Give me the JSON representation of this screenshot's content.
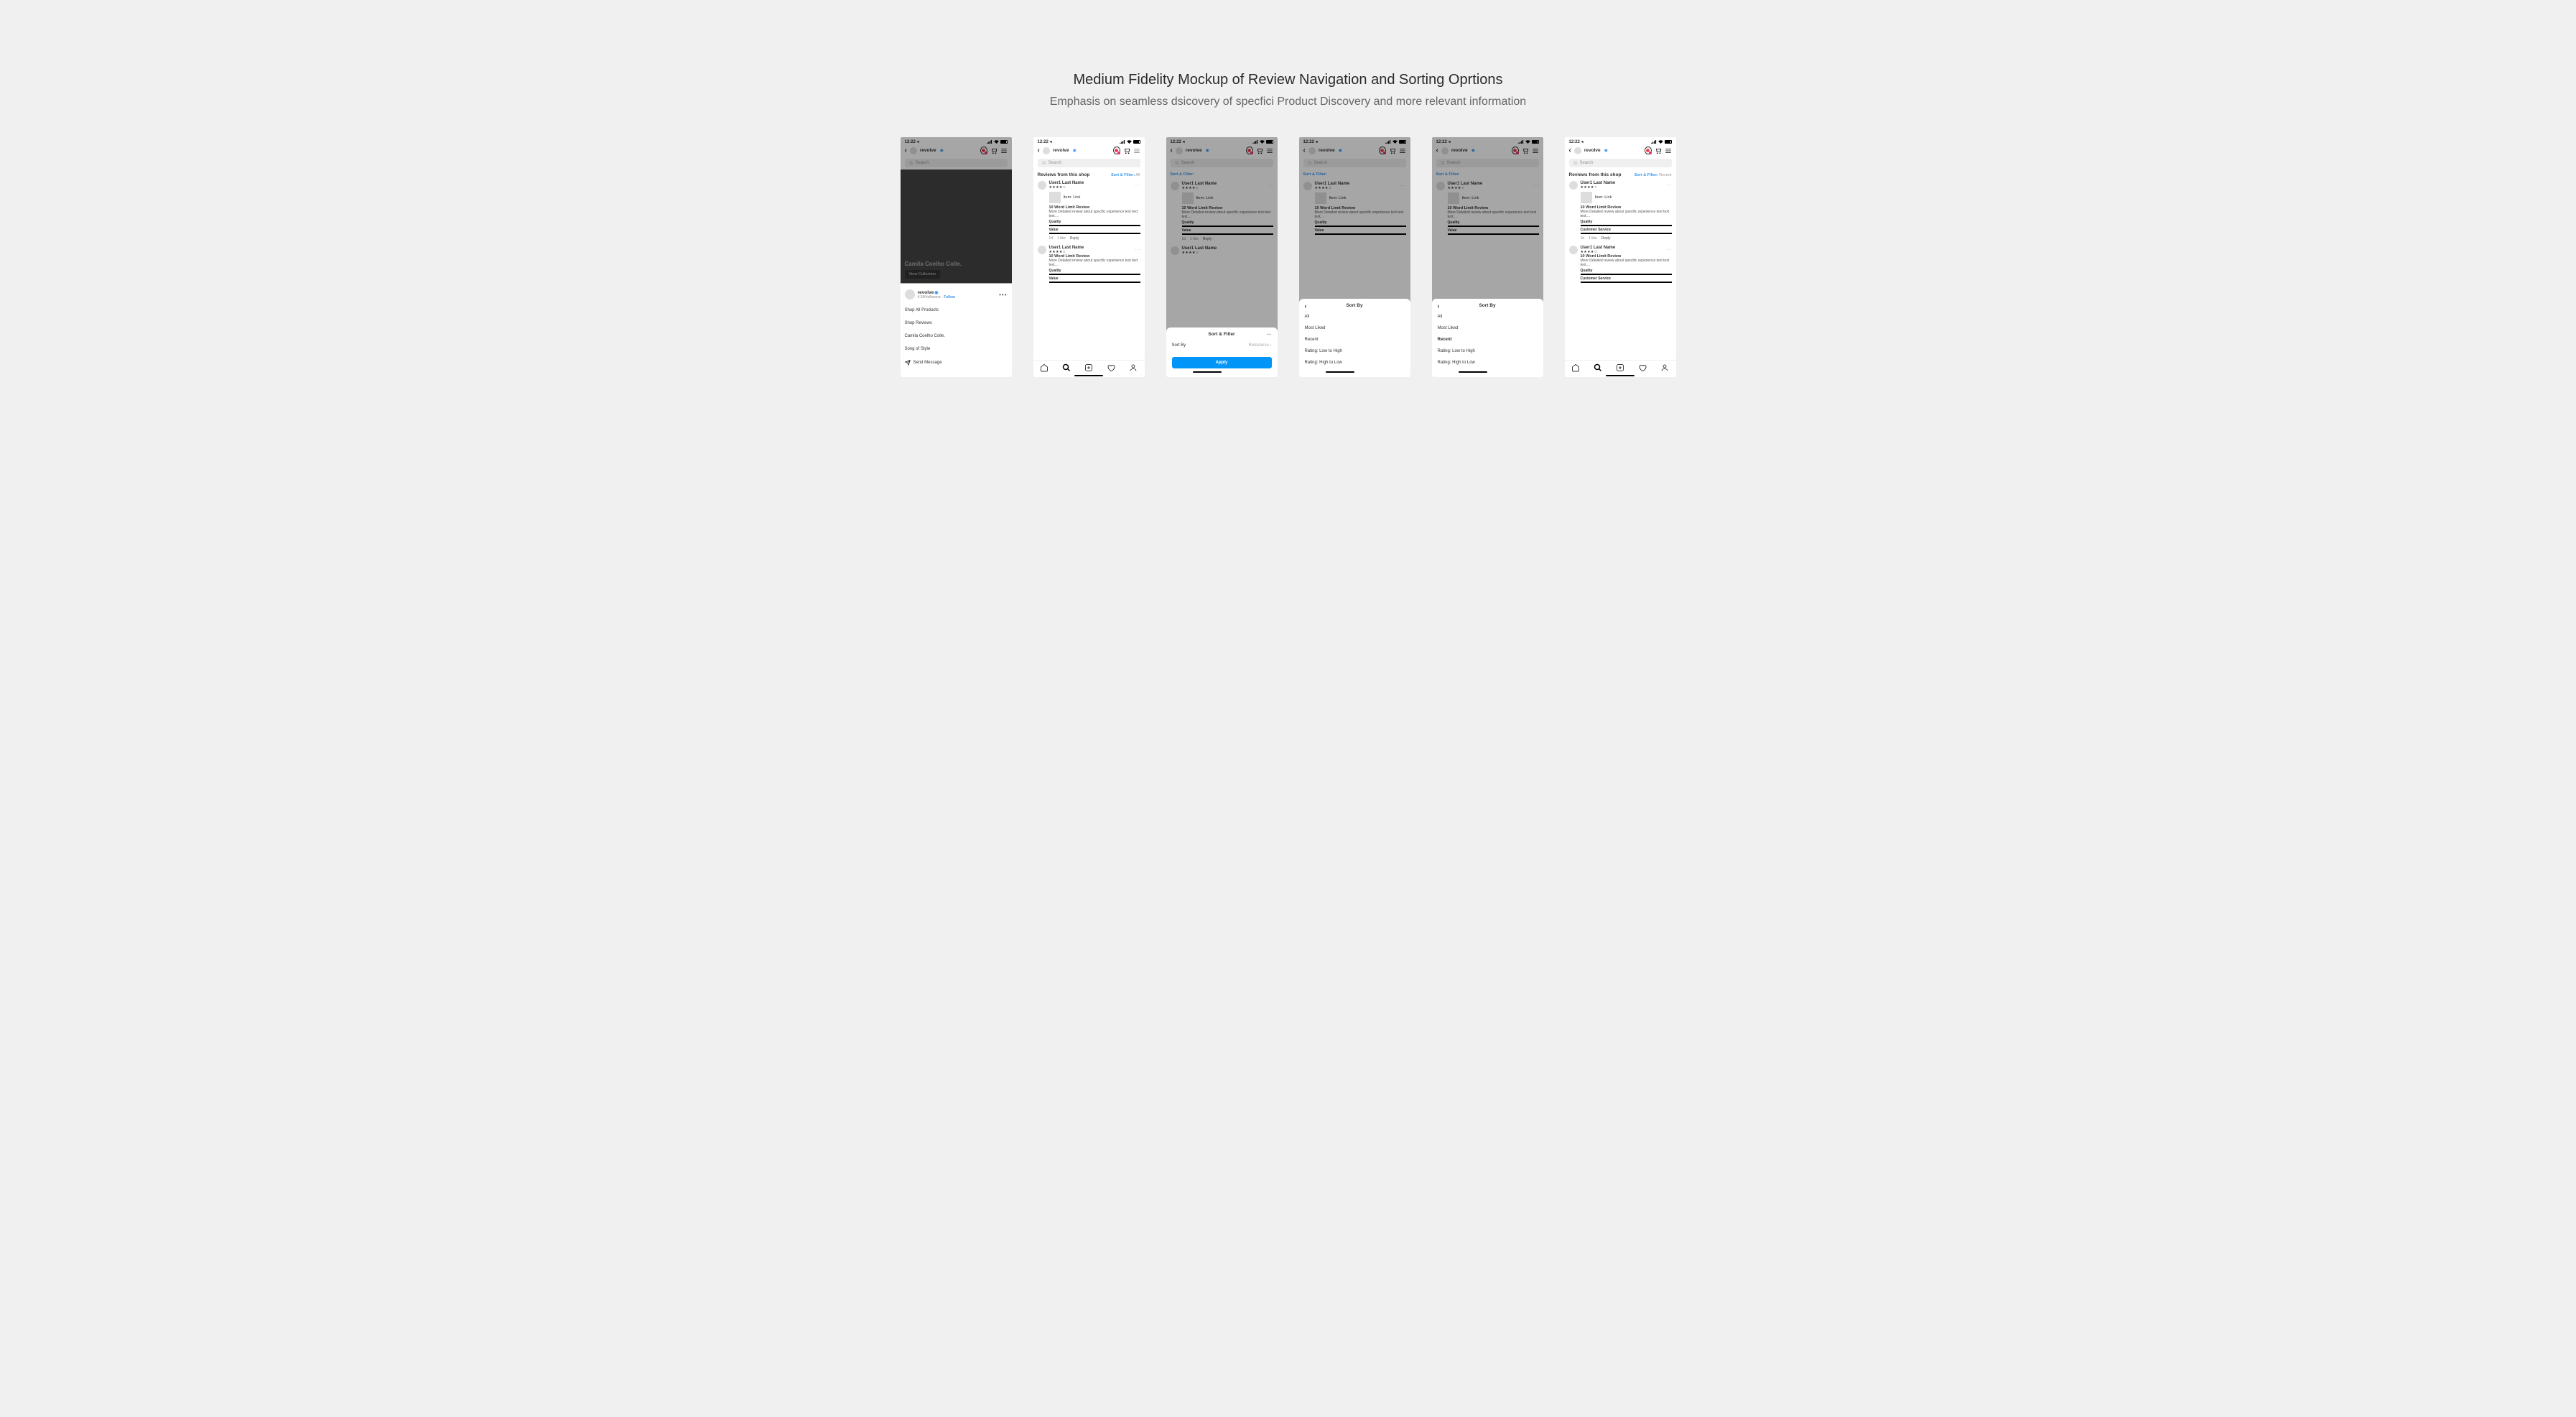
{
  "header": {
    "title": "Medium Fidelity Mockup of Review Navigation and Sorting Oprtions",
    "subtitle": "Emphasis on seamless dsicovery of specfici Product Discovery and more relevant information"
  },
  "status": {
    "time": "12:22 ◂"
  },
  "shop": {
    "name": "revolve",
    "followers": "4.3M followers",
    "follow_label": "Follow"
  },
  "search": {
    "placeholder": "Search"
  },
  "reviews_header": {
    "label": "Reviews from this shop",
    "filter_label": "Sort & Filter:",
    "suffix_all": "All",
    "suffix_recent": "Recent"
  },
  "review": {
    "user": "User1 Last Name",
    "stars": "★★★★☆",
    "item_label": "Item: Link",
    "title": "10 Word Limit Review",
    "body": "More Detailed review about specific experience text text text....",
    "quality_lbl": "Quality",
    "value_lbl": "Value",
    "cservice_lbl": "Customer Service",
    "meta_time": "1d",
    "meta_like": "1 like",
    "meta_reply": "Reply"
  },
  "screen1": {
    "hero_caption": "Camila Coelho Colle.",
    "hero_btn": "View Collection",
    "menu": {
      "shop_all": "Shop All Products",
      "shop_reviews": "Shop Reviews",
      "collection": "Camila Coelho Colle.",
      "song": "Song of Style",
      "send_msg": "Send Message"
    }
  },
  "sort_filter_sheet": {
    "title": "Sort & Filter",
    "sort_by_lbl": "Sort By",
    "relevance": "Relevance",
    "apply": "Apply"
  },
  "sort_by_sheet": {
    "title": "Sort By",
    "options": {
      "all": "All",
      "most_liked": "Most Liked",
      "recent": "Recent",
      "rating_low": "Rating: Low to High",
      "rating_high": "Rating: High to Low"
    }
  }
}
